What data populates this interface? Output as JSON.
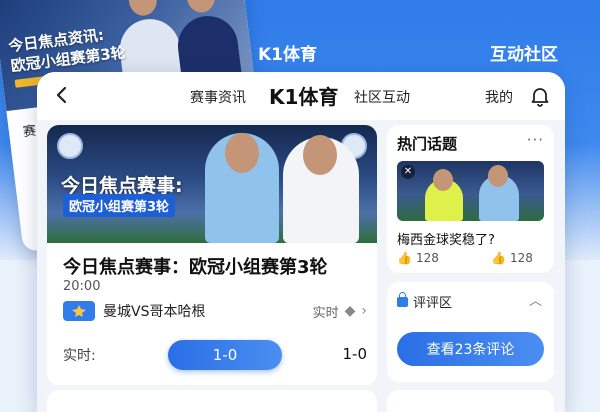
{
  "background": {
    "banner_left": "K1体育",
    "banner_right": "互动社区"
  },
  "ghost_card": {
    "title_line1": "今日焦点资讯:",
    "title_line2": "欧冠小组赛第3轮",
    "body_text": "赛"
  },
  "nav": {
    "tab_news": "赛事资讯",
    "logo": "K1体育",
    "tab_community": "社区互动",
    "tab_mine": "我的"
  },
  "match_card": {
    "hero_title": "今日焦点赛事:",
    "hero_subtitle": "欧冠小组赛第3轮",
    "title": "今日焦点赛事：欧冠小组赛第3轮",
    "time": "20:00",
    "teams": "曼城VS哥本哈根",
    "live_label": "实时",
    "live_icon": "diamond-icon",
    "score_label": "实时:",
    "score_pill": "1-0",
    "score_right": "1-0"
  },
  "hot_topics": {
    "heading": "热门话题",
    "more": "···",
    "question": "梅西金球奖稳了?",
    "likes": "128",
    "dislikes": "128"
  },
  "comments": {
    "heading": "评评区",
    "button": "查看23条评论"
  },
  "colors": {
    "accent": "#2f7cea",
    "banner": "#3e89ee"
  }
}
